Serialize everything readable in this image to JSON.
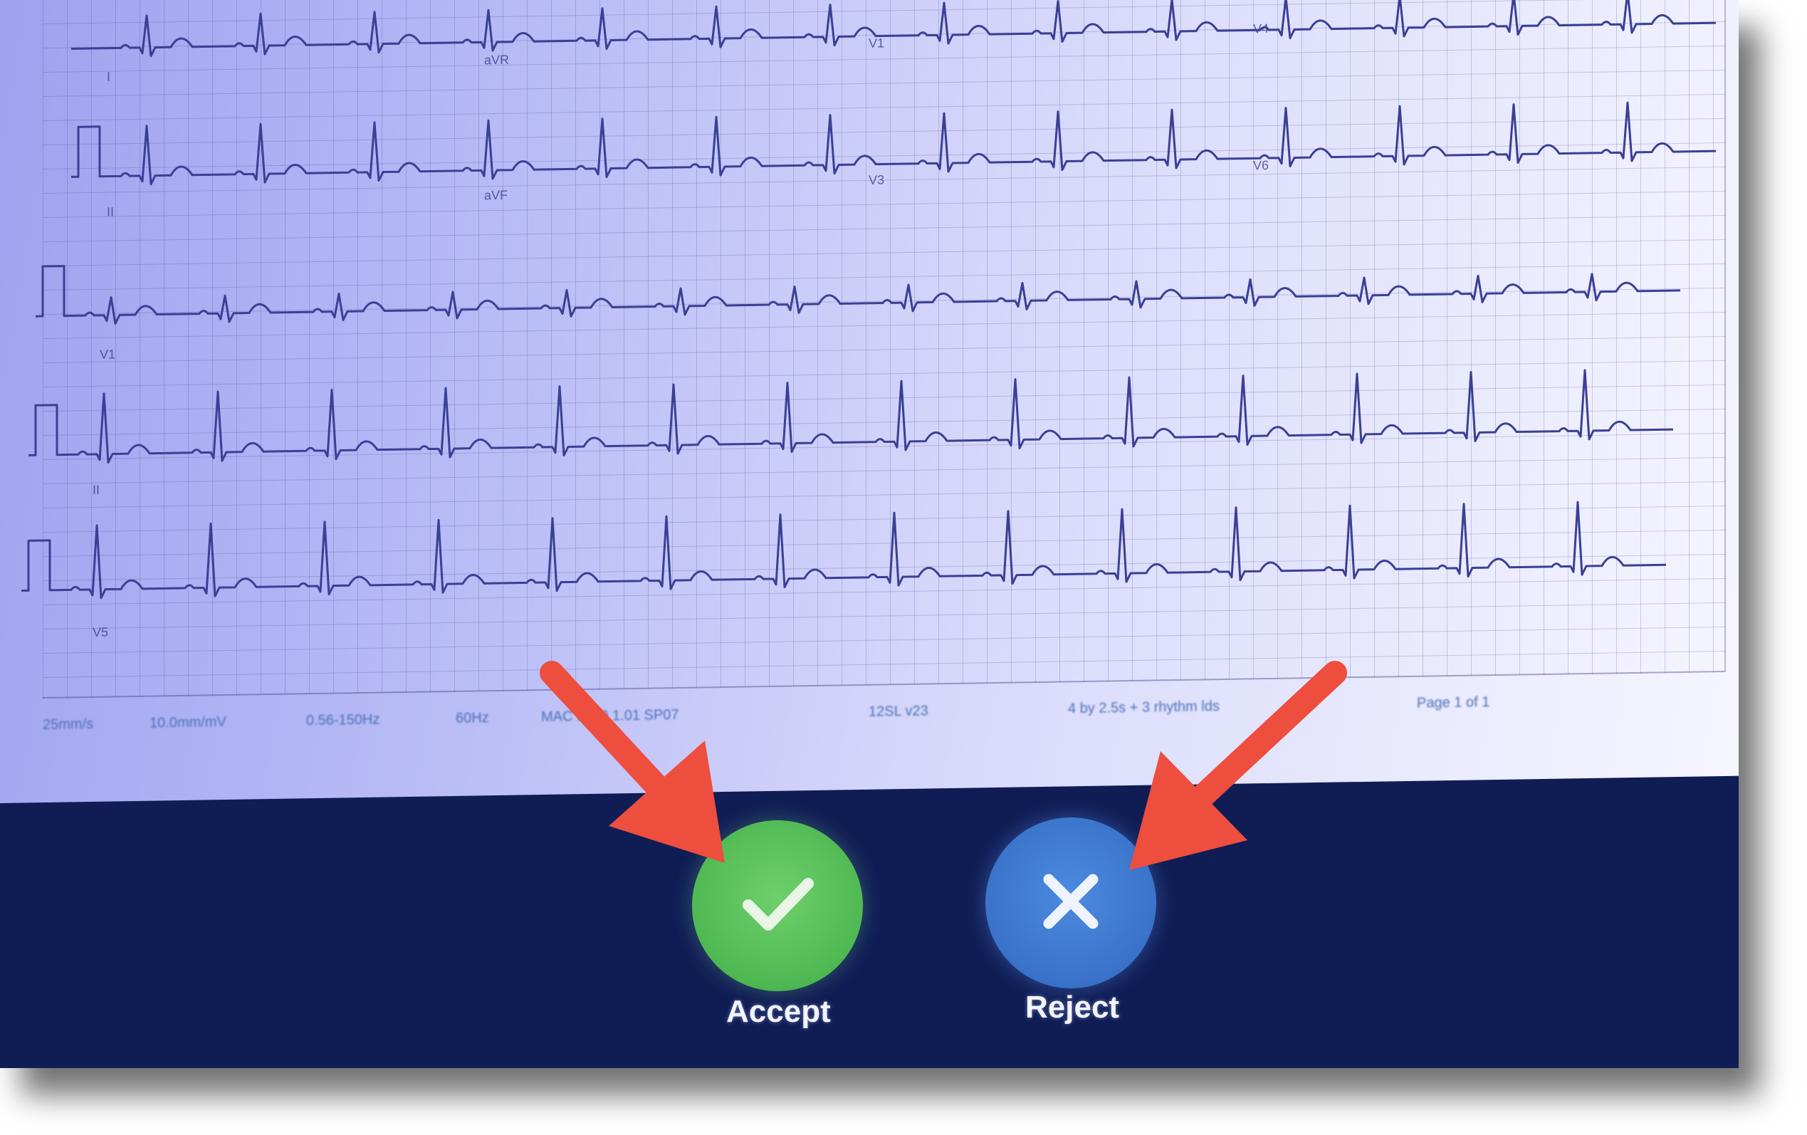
{
  "colors": {
    "accent_arrow": "#ee4e3e",
    "accept": "#55be54",
    "reject": "#3c78d1",
    "screen_bg": "#101d55",
    "trace": "#3b3f95"
  },
  "ecg": {
    "lead_labels": [
      "I",
      "aVR",
      "V1",
      "V4",
      "II",
      "aVF",
      "V3",
      "V6",
      "V1",
      "II",
      "V5"
    ],
    "footer": {
      "speed": "25mm/s",
      "gain": "10.0mm/mV",
      "filter": "0.56-150Hz",
      "notch": "60Hz",
      "device": "MAC 5500 1.01 SP07",
      "version": "12SL v23",
      "format": "4 by 2.5s + 3 rhythm lds",
      "page": "Page 1 of 1"
    }
  },
  "actions": {
    "accept": {
      "label": "Accept",
      "icon": "check-icon"
    },
    "reject": {
      "label": "Reject",
      "icon": "close-icon"
    }
  },
  "annotations": {
    "arrows": [
      "arrow-to-accept",
      "arrow-to-reject"
    ]
  }
}
